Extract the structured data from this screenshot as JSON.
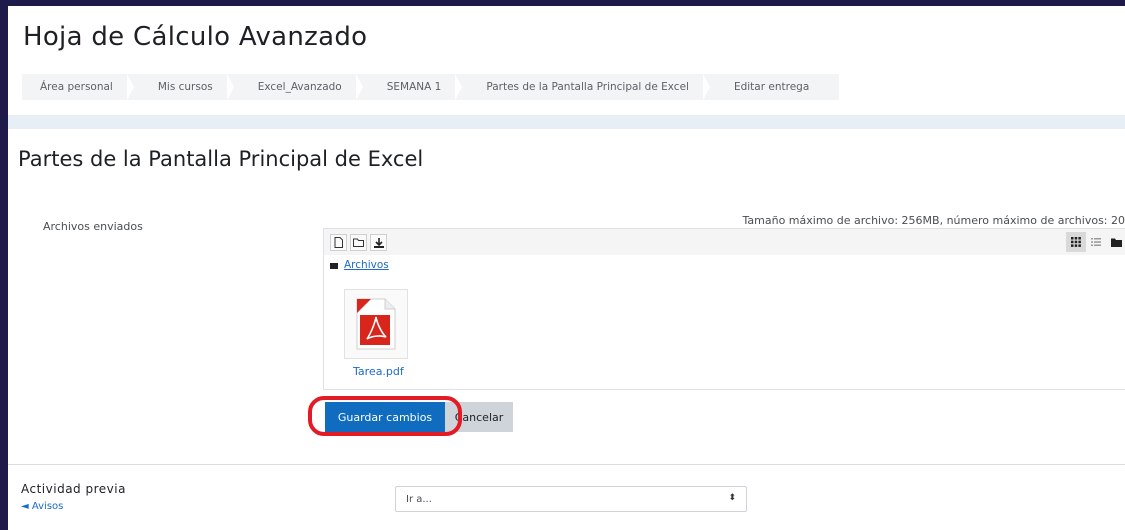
{
  "page": {
    "title": "Hoja de Cálculo Avanzado",
    "section_title": "Partes de la Pantalla Principal de Excel"
  },
  "breadcrumb": [
    "Área personal",
    "Mis cursos",
    "Excel_Avanzado",
    "SEMANA 1",
    "Partes de la Pantalla Principal de Excel",
    "Editar entrega"
  ],
  "form": {
    "files_label": "Archivos enviados",
    "max_size_text": "Tamaño máximo de archivo: 256MB, número máximo de archivos: 20",
    "path_link": "Archivos",
    "file_name": "Tarea.pdf",
    "save_label": "Guardar cambios",
    "cancel_label": "Cancelar"
  },
  "footer": {
    "prev_label": "Actividad previa",
    "prev_link": "◄ Avisos",
    "jump_placeholder": "Ir a..."
  },
  "icons": {
    "new_file": "file-icon",
    "new_folder": "folder-icon",
    "download": "download-icon",
    "grid_view": "grid-icon",
    "list_view": "list-icon",
    "tree_view": "folder-tree-icon",
    "pdf": "pdf-icon"
  },
  "colors": {
    "primary_button": "#0f6cbf",
    "highlight": "#e21b24",
    "link": "#1c6ac9"
  }
}
